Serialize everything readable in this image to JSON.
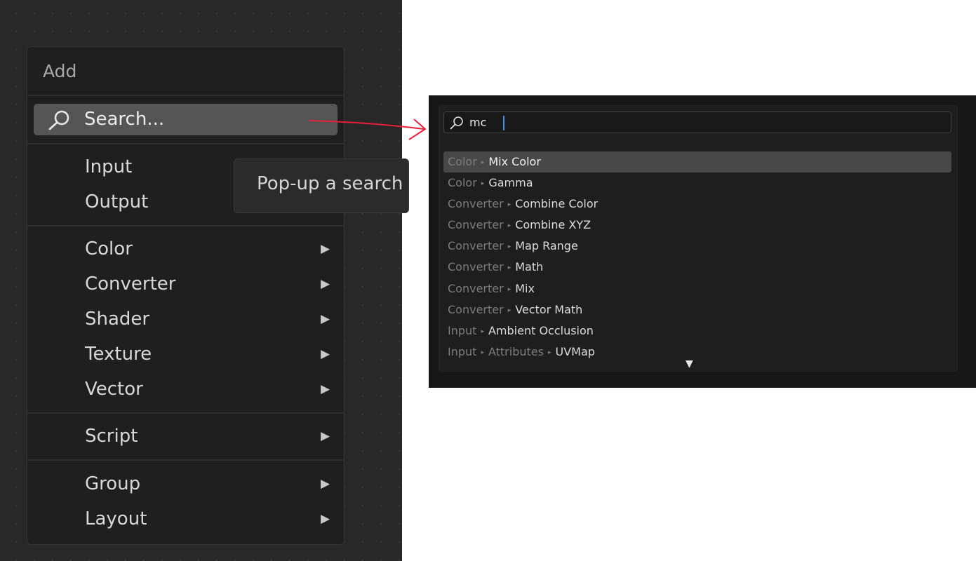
{
  "add_menu": {
    "title": "Add",
    "search_label": "Search...",
    "items": [
      {
        "label": "Input",
        "has_submenu": false
      },
      {
        "label": "Output",
        "has_submenu": false
      },
      {
        "label": "Color",
        "has_submenu": true
      },
      {
        "label": "Converter",
        "has_submenu": true
      },
      {
        "label": "Shader",
        "has_submenu": true
      },
      {
        "label": "Texture",
        "has_submenu": true
      },
      {
        "label": "Vector",
        "has_submenu": true
      },
      {
        "label": "Script",
        "has_submenu": true
      },
      {
        "label": "Group",
        "has_submenu": true
      },
      {
        "label": "Layout",
        "has_submenu": true
      }
    ],
    "submenu_arrow": "▶"
  },
  "tooltip": {
    "text": "Pop-up a search"
  },
  "search_popup": {
    "query": "mc",
    "results": [
      {
        "path": [
          "Color"
        ],
        "name": "Mix Color",
        "selected": true
      },
      {
        "path": [
          "Color"
        ],
        "name": "Gamma"
      },
      {
        "path": [
          "Converter"
        ],
        "name": "Combine Color"
      },
      {
        "path": [
          "Converter"
        ],
        "name": "Combine XYZ"
      },
      {
        "path": [
          "Converter"
        ],
        "name": "Map Range"
      },
      {
        "path": [
          "Converter"
        ],
        "name": "Math"
      },
      {
        "path": [
          "Converter"
        ],
        "name": "Mix"
      },
      {
        "path": [
          "Converter"
        ],
        "name": "Vector Math"
      },
      {
        "path": [
          "Input"
        ],
        "name": "Ambient Occlusion"
      },
      {
        "path": [
          "Input",
          "Attributes"
        ],
        "name": "UVMap"
      }
    ],
    "path_separator": "▸",
    "more_indicator": "▼"
  },
  "icons": {
    "search": "magnifier-icon",
    "annotation": "red-arrow"
  },
  "colors": {
    "annotation_arrow": "#e8203a",
    "caret": "#4b8fe8",
    "selected_row": "#484848"
  }
}
